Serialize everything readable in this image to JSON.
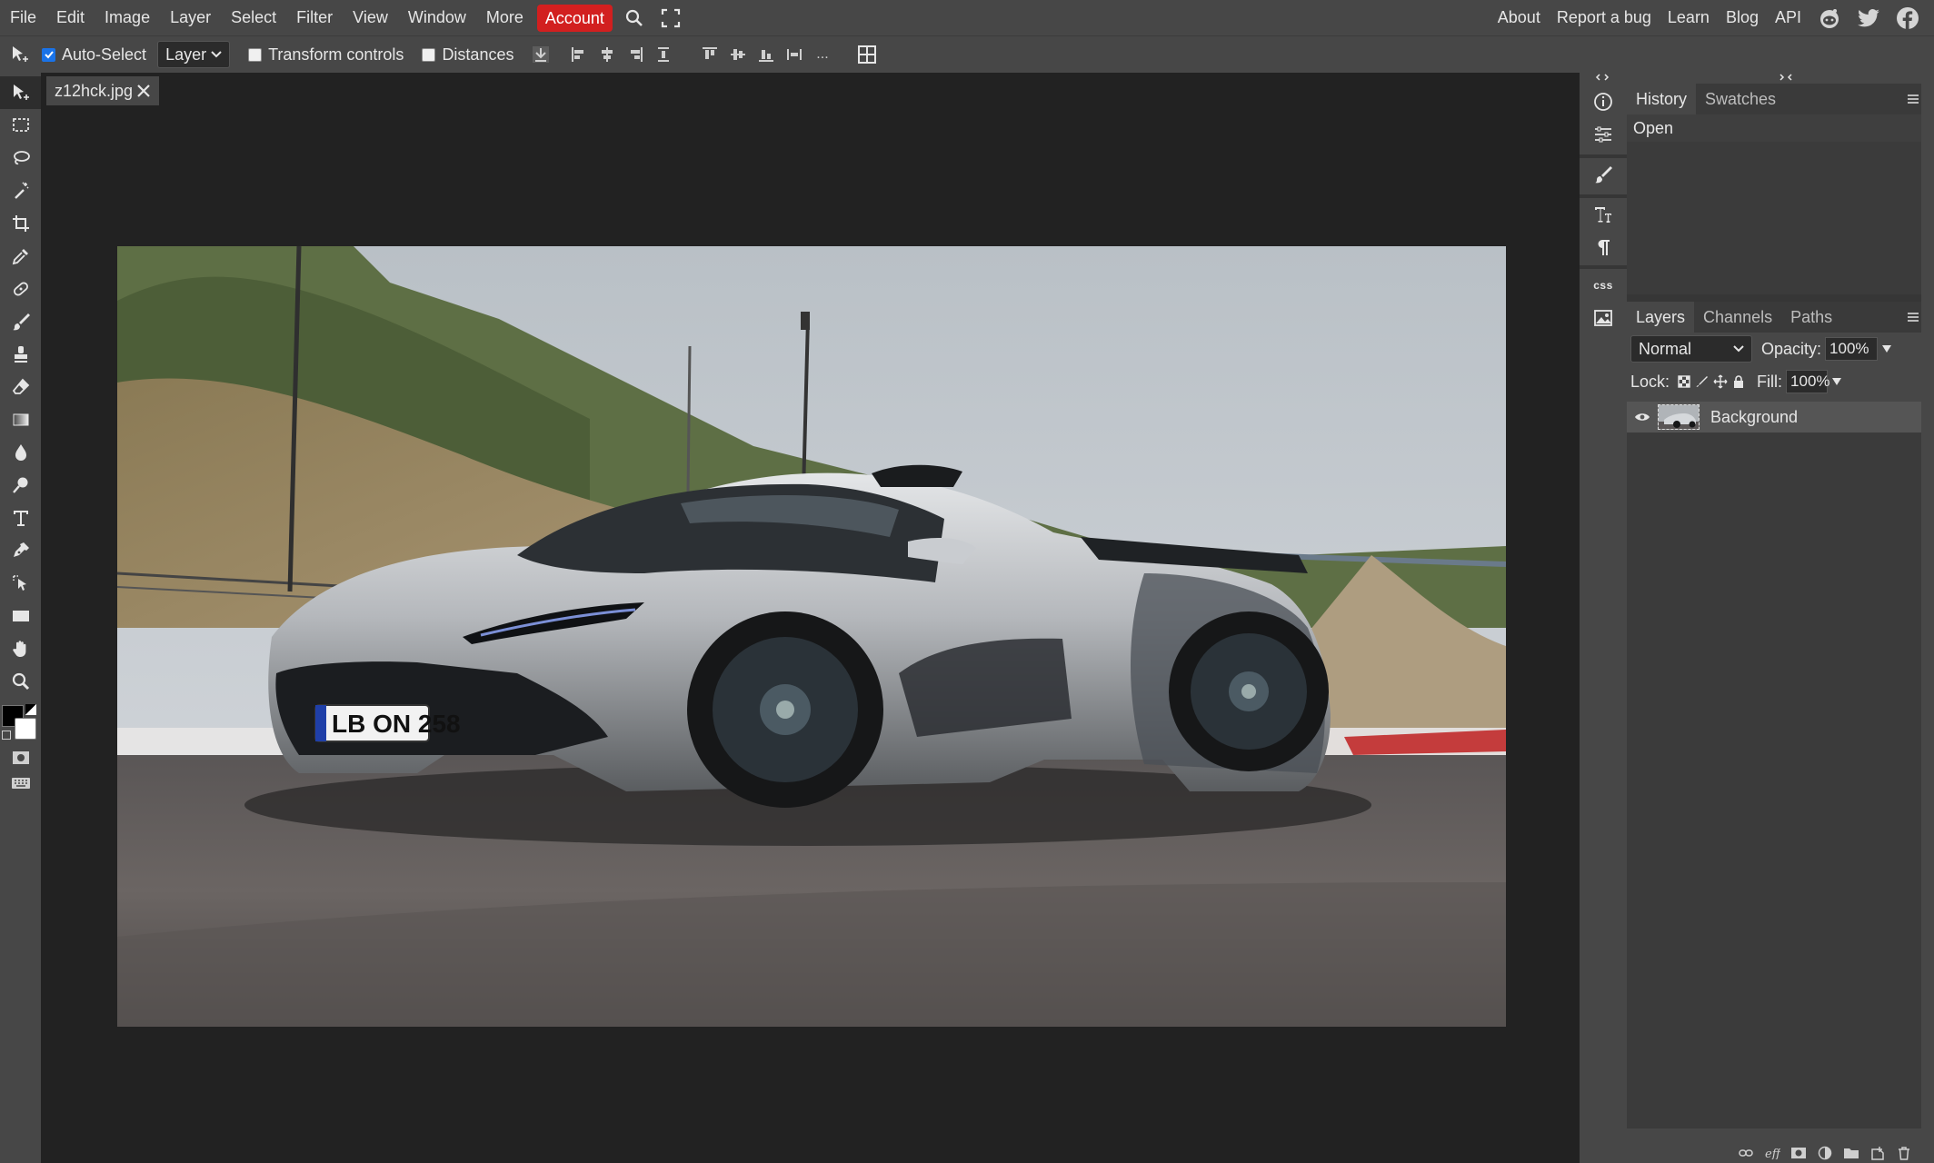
{
  "menu": {
    "items": [
      "File",
      "Edit",
      "Image",
      "Layer",
      "Select",
      "Filter",
      "View",
      "Window",
      "More"
    ],
    "account": "Account"
  },
  "links": [
    "About",
    "Report a bug",
    "Learn",
    "Blog",
    "API"
  ],
  "options": {
    "auto_select_label": "Auto-Select",
    "auto_select_checked": true,
    "target_select": "Layer",
    "transform_label": "Transform controls",
    "distances_label": "Distances",
    "more_label": "..."
  },
  "document": {
    "tab_name": "z12hck.jpg"
  },
  "mini_panel": {
    "css_label": "css"
  },
  "history_panel": {
    "tabs": [
      "History",
      "Swatches"
    ],
    "items": [
      "Open"
    ]
  },
  "layers_panel": {
    "tabs": [
      "Layers",
      "Channels",
      "Paths"
    ],
    "blend_mode": "Normal",
    "opacity_label": "Opacity:",
    "opacity_value": "100%",
    "lock_label": "Lock:",
    "fill_label": "Fill:",
    "fill_value": "100%",
    "layers": [
      {
        "name": "Background",
        "visible": true
      }
    ]
  },
  "colors": {
    "accent": "#d21f1f",
    "foreground_color": "#000000",
    "background_color": "#ffffff",
    "checkbox_blue": "#1a73e8"
  },
  "footer_icons": [
    "link-icon",
    "effects-icon",
    "mask-icon",
    "adjustment-icon",
    "folder-icon",
    "new-layer-icon",
    "trash-icon"
  ]
}
